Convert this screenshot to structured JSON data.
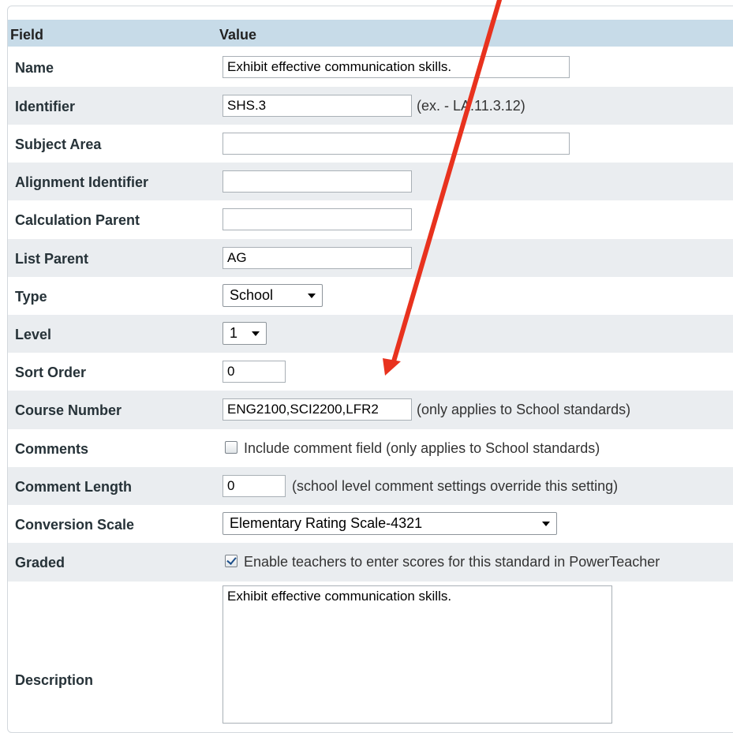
{
  "table": {
    "col_field": "Field",
    "col_value": "Value"
  },
  "rows": {
    "name": {
      "label": "Name",
      "value": "Exhibit effective communication skills."
    },
    "identifier": {
      "label": "Identifier",
      "value": "SHS.3",
      "hint": "(ex. - LA.11.3.12)"
    },
    "subject_area": {
      "label": "Subject Area",
      "value": ""
    },
    "alignment_identifier": {
      "label": "Alignment Identifier",
      "value": ""
    },
    "calculation_parent": {
      "label": "Calculation Parent",
      "value": ""
    },
    "list_parent": {
      "label": "List Parent",
      "value": "AG"
    },
    "type": {
      "label": "Type",
      "selected": "School"
    },
    "level": {
      "label": "Level",
      "selected": "1"
    },
    "sort_order": {
      "label": "Sort Order",
      "value": "0"
    },
    "course_number": {
      "label": "Course Number",
      "value": "ENG2100,SCI2200,LFR2",
      "hint": "(only applies to School standards)"
    },
    "comments": {
      "label": "Comments",
      "checkbox_label": "Include comment field (only applies to School standards)",
      "checked": false
    },
    "comment_length": {
      "label": "Comment Length",
      "value": "0",
      "hint": "(school level comment settings override this setting)"
    },
    "conversion_scale": {
      "label": "Conversion Scale",
      "selected": "Elementary Rating Scale-4321"
    },
    "graded": {
      "label": "Graded",
      "checkbox_label": "Enable teachers to enter scores for this standard in PowerTeacher",
      "checked": true
    },
    "description": {
      "label": "Description",
      "value": "Exhibit effective communication skills."
    }
  },
  "annotation": {
    "arrow_color": "#e8321e"
  }
}
